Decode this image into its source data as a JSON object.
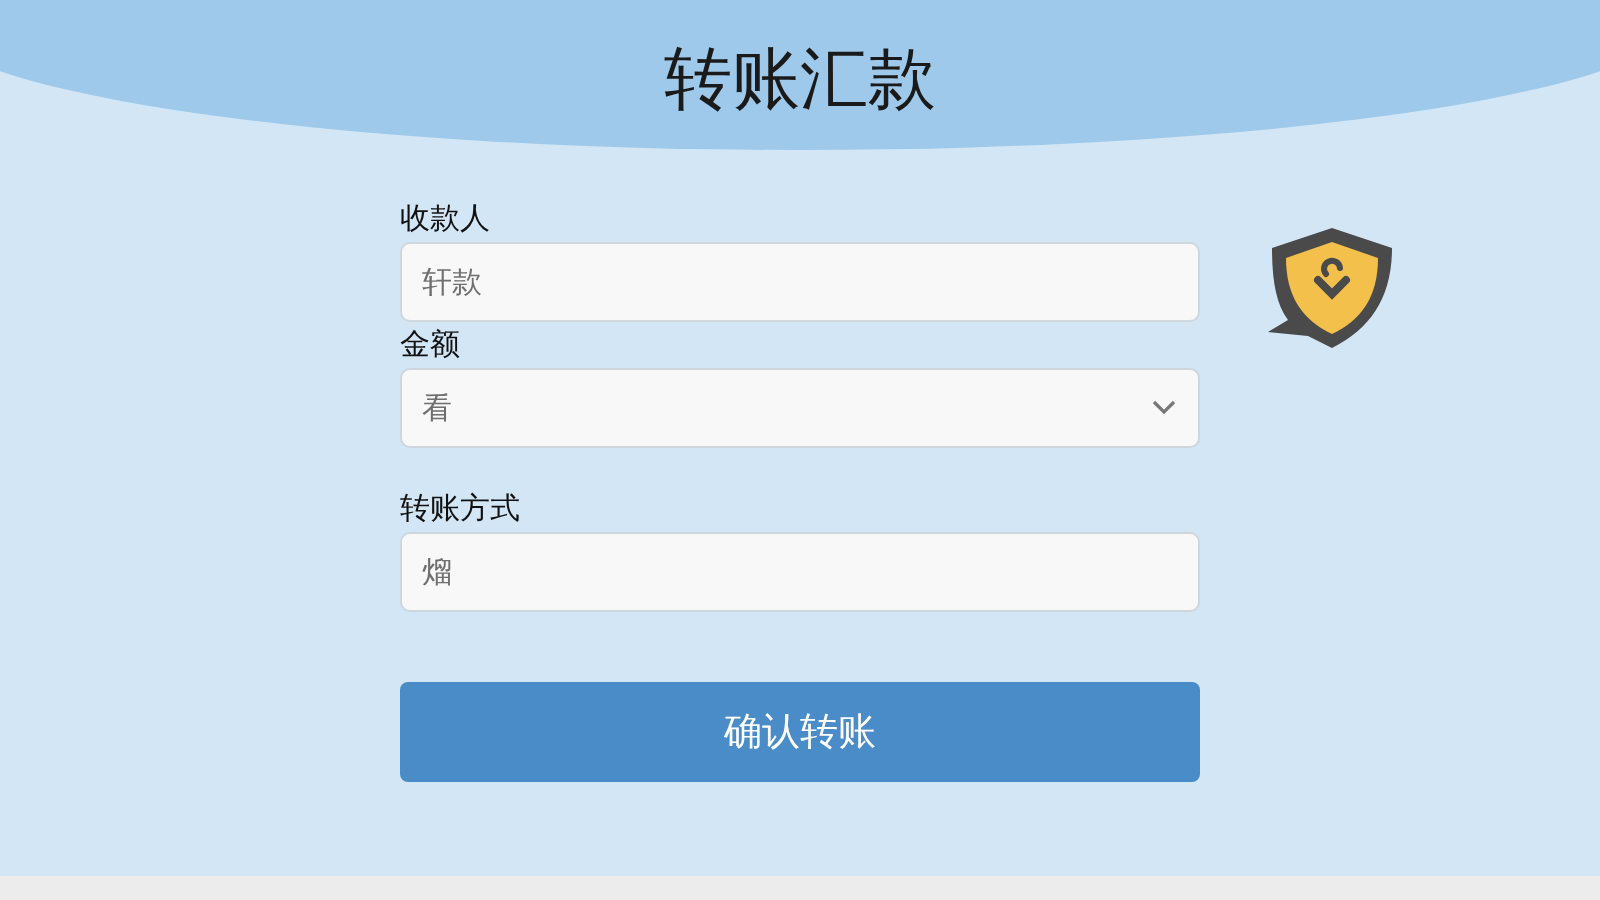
{
  "header": {
    "title": "转账汇款"
  },
  "form": {
    "fields": [
      {
        "kind": "text",
        "label": "收款人",
        "placeholder": "轩款"
      },
      {
        "kind": "select",
        "label": "金额",
        "placeholder": "看"
      },
      {
        "kind": "text",
        "label": "转账方式",
        "placeholder": "熘"
      }
    ],
    "submit": "确认转账"
  }
}
